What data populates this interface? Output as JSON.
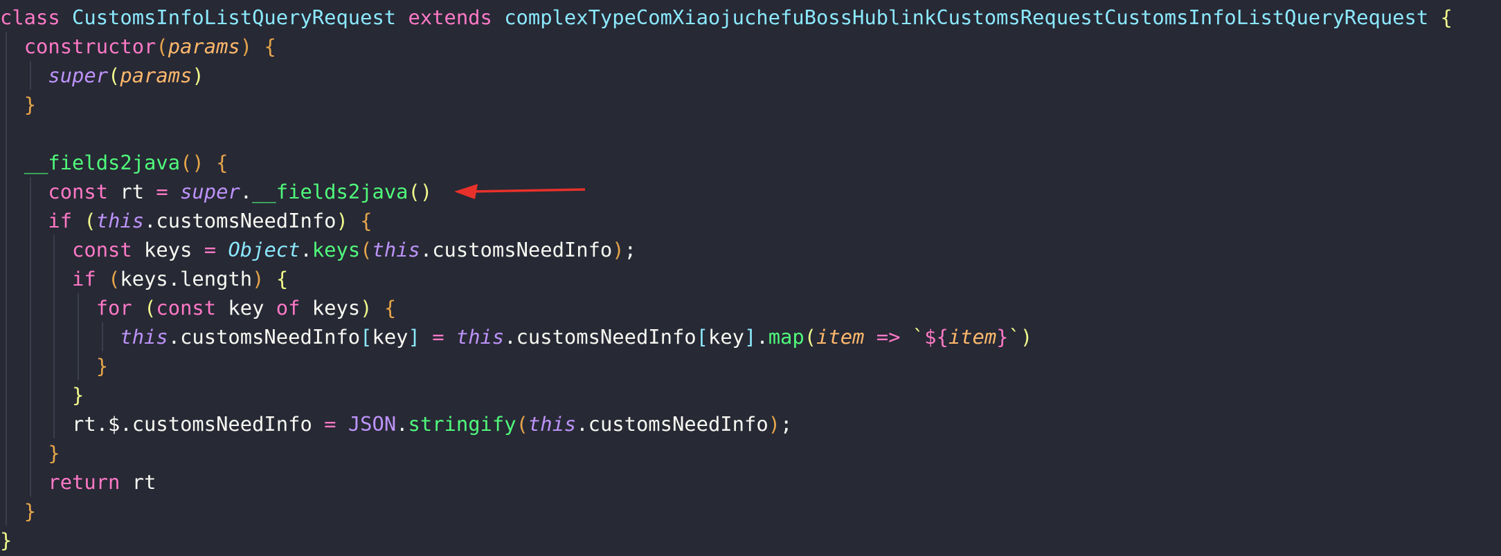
{
  "editor": {
    "background": "#272935",
    "lines": [
      [
        {
          "t": "class",
          "c": "kw"
        },
        {
          "t": " "
        },
        {
          "t": "CustomsInfoListQueryRequest",
          "c": "cls"
        },
        {
          "t": " "
        },
        {
          "t": "extends",
          "c": "kw"
        },
        {
          "t": " "
        },
        {
          "t": "complexTypeComXiaojuchefuBossHublinkCustomsRequestCustomsInfoListQueryRequest",
          "c": "cls"
        },
        {
          "t": " "
        },
        {
          "t": "{",
          "c": "brk1"
        }
      ],
      [
        {
          "t": "  "
        },
        {
          "t": "constructor",
          "c": "kw"
        },
        {
          "t": "(",
          "c": "brk2"
        },
        {
          "t": "params",
          "c": "param"
        },
        {
          "t": ")",
          "c": "brk2"
        },
        {
          "t": " "
        },
        {
          "t": "{",
          "c": "brk2"
        }
      ],
      [
        {
          "t": "    "
        },
        {
          "t": "super",
          "c": "sup"
        },
        {
          "t": "(",
          "c": "brk1"
        },
        {
          "t": "params",
          "c": "param"
        },
        {
          "t": ")",
          "c": "brk1"
        }
      ],
      [
        {
          "t": "  "
        },
        {
          "t": "}",
          "c": "brk2"
        }
      ],
      [],
      [
        {
          "t": "  "
        },
        {
          "t": "__fields2java",
          "c": "fn"
        },
        {
          "t": "()",
          "c": "brk2"
        },
        {
          "t": " "
        },
        {
          "t": "{",
          "c": "brk2"
        }
      ],
      [
        {
          "t": "    "
        },
        {
          "t": "const",
          "c": "kw"
        },
        {
          "t": " rt ",
          "c": "plain"
        },
        {
          "t": "=",
          "c": "op"
        },
        {
          "t": " "
        },
        {
          "t": "super",
          "c": "sup"
        },
        {
          "t": ".",
          "c": "plain"
        },
        {
          "t": "__fields2java",
          "c": "fn"
        },
        {
          "t": "()",
          "c": "brk1"
        }
      ],
      [
        {
          "t": "    "
        },
        {
          "t": "if",
          "c": "kw"
        },
        {
          "t": " "
        },
        {
          "t": "(",
          "c": "brk1"
        },
        {
          "t": "this",
          "c": "sup"
        },
        {
          "t": ".customsNeedInfo",
          "c": "plain"
        },
        {
          "t": ")",
          "c": "brk1"
        },
        {
          "t": " "
        },
        {
          "t": "{",
          "c": "brk2"
        }
      ],
      [
        {
          "t": "      "
        },
        {
          "t": "const",
          "c": "kw"
        },
        {
          "t": " keys ",
          "c": "plain"
        },
        {
          "t": "=",
          "c": "op"
        },
        {
          "t": " "
        },
        {
          "t": "Object",
          "c": "cls it"
        },
        {
          "t": ".",
          "c": "plain"
        },
        {
          "t": "keys",
          "c": "fn"
        },
        {
          "t": "(",
          "c": "brk2"
        },
        {
          "t": "this",
          "c": "sup"
        },
        {
          "t": ".customsNeedInfo",
          "c": "plain"
        },
        {
          "t": ")",
          "c": "brk2"
        },
        {
          "t": ";",
          "c": "plain"
        }
      ],
      [
        {
          "t": "      "
        },
        {
          "t": "if",
          "c": "kw"
        },
        {
          "t": " "
        },
        {
          "t": "(",
          "c": "brk2"
        },
        {
          "t": "keys.length",
          "c": "plain"
        },
        {
          "t": ")",
          "c": "brk2"
        },
        {
          "t": " "
        },
        {
          "t": "{",
          "c": "brk1"
        }
      ],
      [
        {
          "t": "        "
        },
        {
          "t": "for",
          "c": "kw"
        },
        {
          "t": " "
        },
        {
          "t": "(",
          "c": "brk1"
        },
        {
          "t": "const",
          "c": "kw"
        },
        {
          "t": " key ",
          "c": "plain"
        },
        {
          "t": "of",
          "c": "kw"
        },
        {
          "t": " keys",
          "c": "plain"
        },
        {
          "t": ")",
          "c": "brk1"
        },
        {
          "t": " "
        },
        {
          "t": "{",
          "c": "brk2"
        }
      ],
      [
        {
          "t": "          "
        },
        {
          "t": "this",
          "c": "sup"
        },
        {
          "t": ".customsNeedInfo",
          "c": "plain"
        },
        {
          "t": "[",
          "c": "brk3"
        },
        {
          "t": "key",
          "c": "plain"
        },
        {
          "t": "]",
          "c": "brk3"
        },
        {
          "t": " "
        },
        {
          "t": "=",
          "c": "op"
        },
        {
          "t": " "
        },
        {
          "t": "this",
          "c": "sup"
        },
        {
          "t": ".customsNeedInfo",
          "c": "plain"
        },
        {
          "t": "[",
          "c": "brk3"
        },
        {
          "t": "key",
          "c": "plain"
        },
        {
          "t": "]",
          "c": "brk3"
        },
        {
          "t": ".",
          "c": "plain"
        },
        {
          "t": "map",
          "c": "fn"
        },
        {
          "t": "(",
          "c": "brk1"
        },
        {
          "t": "item",
          "c": "param"
        },
        {
          "t": " "
        },
        {
          "t": "=>",
          "c": "op"
        },
        {
          "t": " "
        },
        {
          "t": "`",
          "c": "str"
        },
        {
          "t": "${",
          "c": "tpl"
        },
        {
          "t": "item",
          "c": "param"
        },
        {
          "t": "}",
          "c": "tpl"
        },
        {
          "t": "`",
          "c": "str"
        },
        {
          "t": ")",
          "c": "brk1"
        }
      ],
      [
        {
          "t": "        "
        },
        {
          "t": "}",
          "c": "brk2"
        }
      ],
      [
        {
          "t": "      "
        },
        {
          "t": "}",
          "c": "brk1"
        }
      ],
      [
        {
          "t": "      "
        },
        {
          "t": "rt.$.customsNeedInfo ",
          "c": "plain"
        },
        {
          "t": "=",
          "c": "op"
        },
        {
          "t": " "
        },
        {
          "t": "JSON",
          "c": "num"
        },
        {
          "t": ".",
          "c": "plain"
        },
        {
          "t": "stringify",
          "c": "fn"
        },
        {
          "t": "(",
          "c": "brk2"
        },
        {
          "t": "this",
          "c": "sup"
        },
        {
          "t": ".customsNeedInfo",
          "c": "plain"
        },
        {
          "t": ")",
          "c": "brk2"
        },
        {
          "t": ";",
          "c": "plain"
        }
      ],
      [
        {
          "t": "    "
        },
        {
          "t": "}",
          "c": "brk2"
        }
      ],
      [
        {
          "t": "    "
        },
        {
          "t": "return",
          "c": "kw"
        },
        {
          "t": " rt",
          "c": "plain"
        }
      ],
      [
        {
          "t": "  "
        },
        {
          "t": "}",
          "c": "brk2"
        }
      ],
      [
        {
          "t": "}",
          "c": "brk1"
        }
      ]
    ]
  },
  "annotation": {
    "arrow_color": "#e8312b",
    "arrow_points_to": "super.__fields2java()"
  }
}
